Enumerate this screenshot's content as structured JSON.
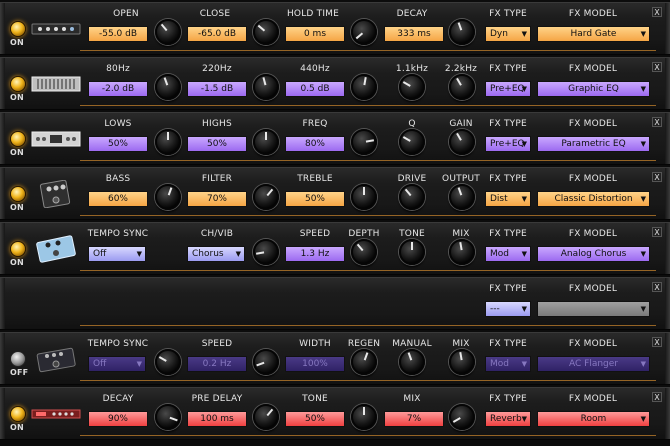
{
  "common": {
    "fx_type_label": "FX TYPE",
    "fx_model_label": "FX MODEL",
    "close_label": "X"
  },
  "rows": [
    {
      "power": "ON",
      "device_icon": "gate-icon",
      "params": [
        {
          "label": "OPEN",
          "value": "-55.0 dB"
        },
        {
          "label": "CLOSE",
          "value": "-65.0 dB"
        },
        {
          "label": "HOLD TIME",
          "value": "0 ms"
        },
        {
          "label": "DECAY",
          "value": "333 ms"
        }
      ],
      "fx_type": "Dyn",
      "fx_model": "Hard Gate"
    },
    {
      "power": "ON",
      "device_icon": "graphic-eq-icon",
      "params": [
        {
          "label": "80Hz",
          "value": "-2.0 dB"
        },
        {
          "label": "220Hz",
          "value": "-1.5 dB"
        },
        {
          "label": "440Hz",
          "value": "0.5 dB"
        },
        {
          "label": "1.1kHz"
        },
        {
          "label": "2.2kHz"
        }
      ],
      "fx_type": "Pre+EQ",
      "fx_model": "Graphic EQ"
    },
    {
      "power": "ON",
      "device_icon": "parametric-eq-icon",
      "params": [
        {
          "label": "LOWS",
          "value": "50%"
        },
        {
          "label": "HIGHS",
          "value": "50%"
        },
        {
          "label": "FREQ",
          "value": "80%"
        },
        {
          "label": "Q"
        },
        {
          "label": "GAIN"
        }
      ],
      "fx_type": "Pre+EQ",
      "fx_model": "Parametric EQ"
    },
    {
      "power": "ON",
      "device_icon": "distortion-pedal-icon",
      "params": [
        {
          "label": "BASS",
          "value": "60%"
        },
        {
          "label": "FILTER",
          "value": "70%"
        },
        {
          "label": "TREBLE",
          "value": "50%"
        },
        {
          "label": "DRIVE"
        },
        {
          "label": "OUTPUT"
        }
      ],
      "fx_type": "Dist",
      "fx_model": "Classic Distortion"
    },
    {
      "power": "ON",
      "device_icon": "chorus-pedal-icon",
      "params": [
        {
          "label": "TEMPO SYNC",
          "value": "Off"
        },
        {
          "label": "CH/VIB",
          "value": "Chorus"
        },
        {
          "label": "SPEED",
          "value": "1.3 Hz"
        },
        {
          "label": "DEPTH"
        },
        {
          "label": "TONE"
        },
        {
          "label": "MIX"
        }
      ],
      "fx_type": "Mod",
      "fx_model": "Analog Chorus"
    },
    {
      "power": "",
      "params": [],
      "fx_type": "---",
      "fx_model": ""
    },
    {
      "power": "OFF",
      "device_icon": "flanger-pedal-icon",
      "params": [
        {
          "label": "TEMPO SYNC",
          "value": "Off"
        },
        {
          "label": "SPEED",
          "value": "0.2 Hz"
        },
        {
          "label": "WIDTH",
          "value": "100%"
        },
        {
          "label": "REGEN"
        },
        {
          "label": "MANUAL"
        },
        {
          "label": "MIX"
        }
      ],
      "fx_type": "Mod",
      "fx_model": "AC Flanger"
    },
    {
      "power": "ON",
      "device_icon": "reverb-rack-icon",
      "params": [
        {
          "label": "DECAY",
          "value": "90%"
        },
        {
          "label": "PRE DELAY",
          "value": "100 ms"
        },
        {
          "label": "TONE",
          "value": "50%"
        },
        {
          "label": "MIX",
          "value": "7%"
        }
      ],
      "fx_type": "Reverb",
      "fx_model": "Room"
    }
  ],
  "colors": {
    "accent_orange": "#f5a545",
    "accent_purple": "#9c6af0",
    "accent_red": "#ef4040",
    "rail": "#b7792a"
  }
}
